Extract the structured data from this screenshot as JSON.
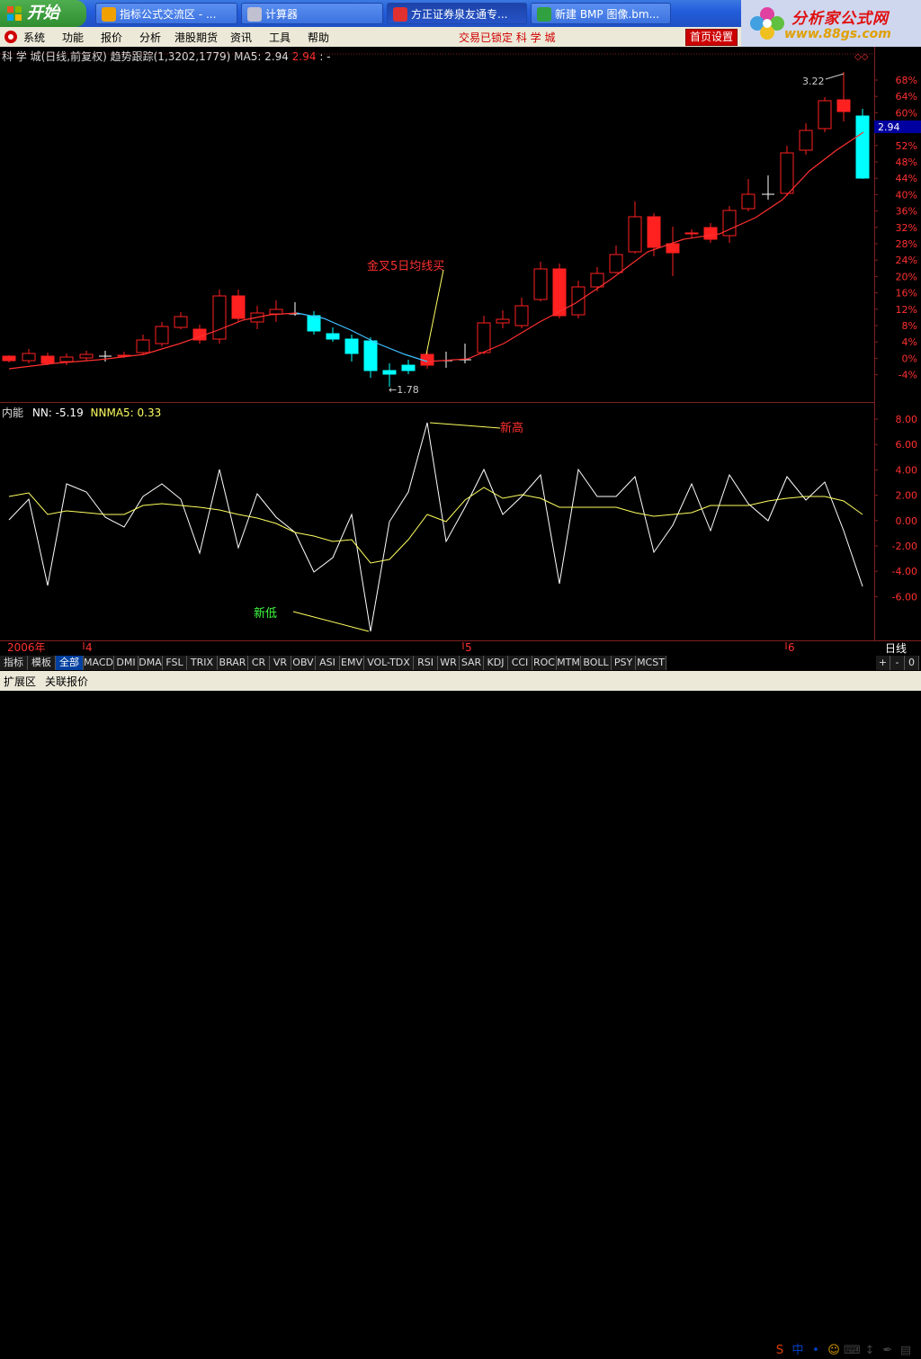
{
  "taskbar": {
    "start_label": "开始",
    "tasks": [
      {
        "label": "指标公式交流区 - ..."
      },
      {
        "label": "计算器"
      },
      {
        "label": "方正证券泉友通专..."
      },
      {
        "label": "新建 BMP 图像.bm..."
      }
    ]
  },
  "brand": {
    "name": "分析家公式网",
    "url": "www.88gs.com"
  },
  "menubar": {
    "items": [
      "系统",
      "功能",
      "报价",
      "分析",
      "港股期货",
      "资讯",
      "工具",
      "帮助"
    ],
    "lock_status": "交易已锁定 科 学 城",
    "home_button": "首页设置"
  },
  "stock_header": {
    "name": "科 学 城(日线,前复权) 趋势跟踪(1,3202,1779)",
    "ma5_label": "MA5: 2.94",
    "ma5_value": "2.94",
    "tail": ": -"
  },
  "indicator_header": {
    "name": "内能",
    "nn_label": "NN: -5.19",
    "nnma5_label": "NNMA5: 0.33"
  },
  "annotations": {
    "golden_cross": "金叉5日均线买",
    "low_price": "←1.78",
    "high_price": "3.22",
    "new_high": "新高",
    "new_low": "新低",
    "last_price": "2.94"
  },
  "price_axis": [
    "68%",
    "64%",
    "60%",
    "56%",
    "52%",
    "48%",
    "44%",
    "40%",
    "36%",
    "32%",
    "28%",
    "24%",
    "20%",
    "16%",
    "12%",
    "8%",
    "4%",
    "0%",
    "-4%"
  ],
  "indicator_axis": [
    "8.00",
    "6.00",
    "4.00",
    "2.00",
    "0.00",
    "-2.00",
    "-4.00",
    "-6.00"
  ],
  "time_axis": {
    "year": "2006年",
    "m4": "4",
    "m5": "5",
    "m6": "6",
    "period": "日线"
  },
  "tabs": {
    "left": [
      "指标",
      "模板",
      "全部"
    ],
    "indicators": [
      "MACD",
      "DMI",
      "DMA",
      "FSL",
      "TRIX",
      "BRAR",
      "CR",
      "VR",
      "OBV",
      "ASI",
      "EMV",
      "VOL-TDX",
      "RSI",
      "WR",
      "SAR",
      "KDJ",
      "CCI",
      "ROC",
      "MTM",
      "BOLL",
      "PSY",
      "MCST"
    ],
    "right": [
      "+",
      "-",
      "0"
    ]
  },
  "status_bar": {
    "items": [
      "扩展区",
      "关联报价"
    ]
  },
  "ime": [
    "S",
    "中",
    "•",
    "☺",
    "⌨",
    "↕",
    "✒",
    "▤"
  ],
  "colors": {
    "up": "#ff2020",
    "down": "#00ffff",
    "bg": "#000000",
    "ma": "#ff3030",
    "ma_cyan": "#40c0ff"
  }
}
